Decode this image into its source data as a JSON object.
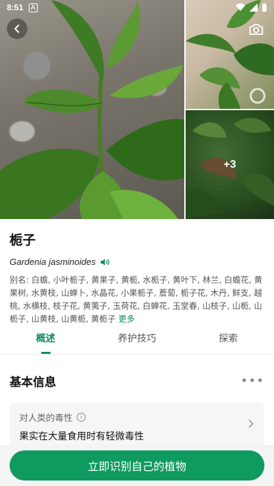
{
  "status": {
    "time": "8:51",
    "indicator": "A"
  },
  "gallery": {
    "more_count": "+3"
  },
  "plant": {
    "name": "栀子",
    "latin": "Gardenia jasminoides",
    "aliases": "别名: 白蟾, 小叶栀子, 黄果子, 黄栀, 水栀子, 黄叶下, 林兰, 白蟾花, 黄果树, 水黄枝, 山蝉卜, 水晶花, 小果栀子, 薝蔔, 栀子花, 木丹, 鲜支, 越桃, 水横枝, 枝子花, 黄荑子, 玉荷花, 白蝉花, 玉堂春, 山枝子, 山栀, 山栀子, 山黄枝, 山黄栀, 黄栀子",
    "more": "更多"
  },
  "tabs": [
    {
      "label": "概述"
    },
    {
      "label": "养护技巧"
    },
    {
      "label": "探索"
    }
  ],
  "section": {
    "title": "基本信息",
    "more": "•••"
  },
  "toxicity": {
    "label": "对人类的毒性",
    "value": "果实在大量食用时有轻微毒性"
  },
  "cta": {
    "label": "立即识别自己的植物"
  },
  "colors": {
    "accent": "#0f9a5f"
  }
}
